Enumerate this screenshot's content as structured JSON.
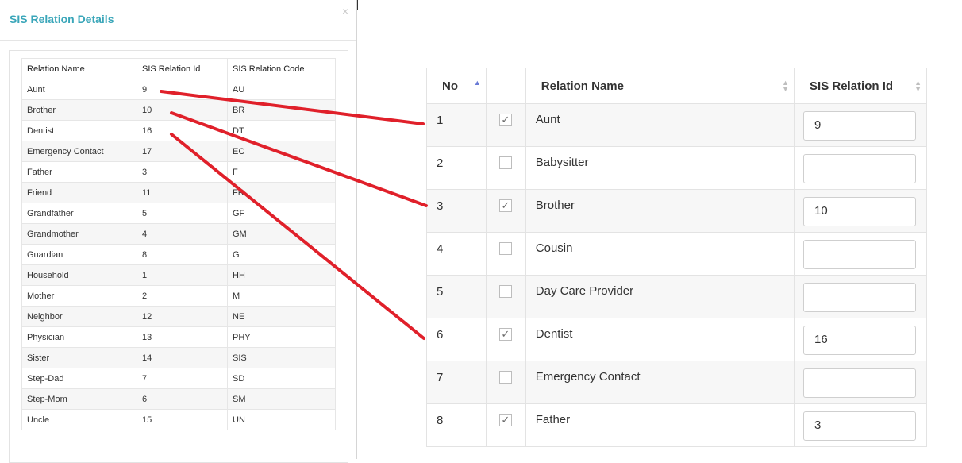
{
  "modal": {
    "title": "SIS Relation Details",
    "close": "×"
  },
  "sis_table": {
    "headers": [
      "Relation Name",
      "SIS Relation Id",
      "SIS Relation Code"
    ],
    "rows": [
      [
        "Aunt",
        "9",
        "AU"
      ],
      [
        "Brother",
        "10",
        "BR"
      ],
      [
        "Dentist",
        "16",
        "DT"
      ],
      [
        "Emergency Contact",
        "17",
        "EC"
      ],
      [
        "Father",
        "3",
        "F"
      ],
      [
        "Friend",
        "11",
        "FR"
      ],
      [
        "Grandfather",
        "5",
        "GF"
      ],
      [
        "Grandmother",
        "4",
        "GM"
      ],
      [
        "Guardian",
        "8",
        "G"
      ],
      [
        "Household",
        "1",
        "HH"
      ],
      [
        "Mother",
        "2",
        "M"
      ],
      [
        "Neighbor",
        "12",
        "NE"
      ],
      [
        "Physician",
        "13",
        "PHY"
      ],
      [
        "Sister",
        "14",
        "SIS"
      ],
      [
        "Step-Dad",
        "7",
        "SD"
      ],
      [
        "Step-Mom",
        "6",
        "SM"
      ],
      [
        "Uncle",
        "15",
        "UN"
      ]
    ]
  },
  "grid": {
    "headers": {
      "no": "No",
      "relation_name": "Relation Name",
      "sis_relation_id": "SIS Relation Id"
    },
    "rows": [
      {
        "no": "1",
        "checked": true,
        "name": "Aunt",
        "sis_id": "9"
      },
      {
        "no": "2",
        "checked": false,
        "name": "Babysitter",
        "sis_id": ""
      },
      {
        "no": "3",
        "checked": true,
        "name": "Brother",
        "sis_id": "10"
      },
      {
        "no": "4",
        "checked": false,
        "name": "Cousin",
        "sis_id": ""
      },
      {
        "no": "5",
        "checked": false,
        "name": "Day Care Provider",
        "sis_id": ""
      },
      {
        "no": "6",
        "checked": true,
        "name": "Dentist",
        "sis_id": "16"
      },
      {
        "no": "7",
        "checked": false,
        "name": "Emergency Contact",
        "sis_id": ""
      },
      {
        "no": "8",
        "checked": true,
        "name": "Father",
        "sis_id": "3"
      }
    ]
  },
  "colors": {
    "title": "#3aa6b9",
    "annotation": "#e0202a",
    "sort_active": "#6a7bd6"
  },
  "icons": {
    "close": "close-icon",
    "sort_asc": "sort-asc-icon",
    "sort": "sort-icon",
    "check": "checkmark-icon"
  },
  "check_glyph": "✓"
}
